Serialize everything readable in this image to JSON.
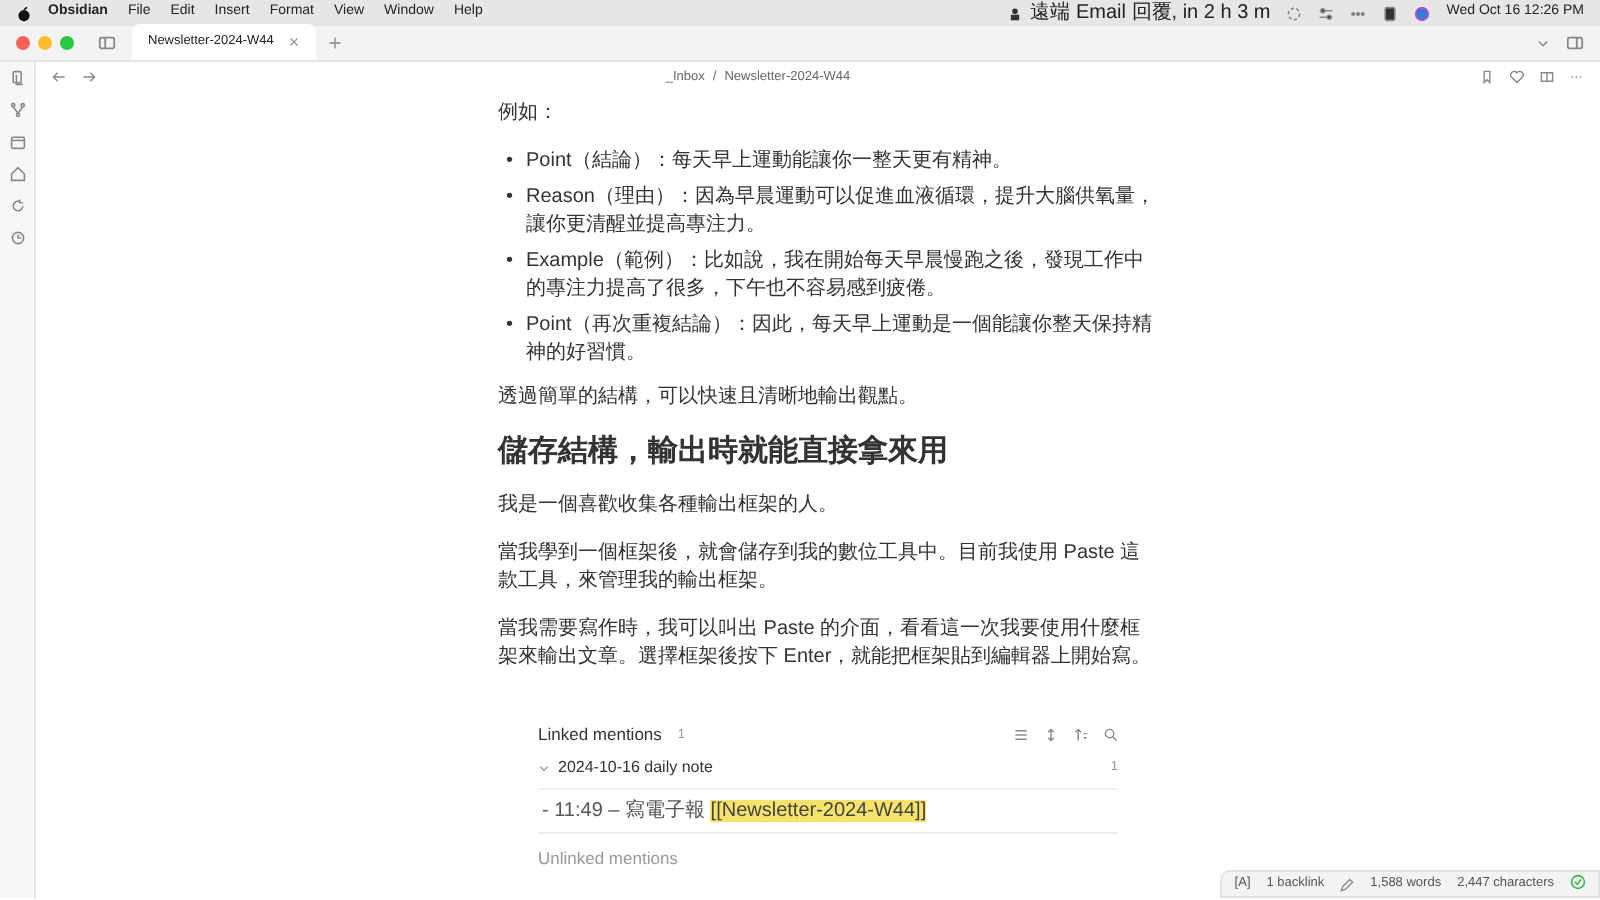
{
  "menubar": {
    "app": "Obsidian",
    "menus": [
      "File",
      "Edit",
      "Insert",
      "Format",
      "View",
      "Window",
      "Help"
    ],
    "reminder": "遠端 Email 回覆, in 2 h 3 m",
    "clock": "Wed Oct 16  12:26 PM"
  },
  "tabs": [
    {
      "title": "Newsletter-2024-W44",
      "selected": true
    }
  ],
  "breadcrumb": {
    "folder": "_Inbox",
    "separator": "/",
    "file": "Newsletter-2024-W44"
  },
  "content": [
    {
      "kind": "paragraph",
      "text": "例如："
    },
    {
      "kind": "bullets",
      "marker": "•",
      "items": [
        "Point（結論）：每天早上運動能讓你一整天更有精神。",
        "Reason（理由）：因為早晨運動可以促進血液循環，提升大腦供氧量，讓你更清醒並提高專注力。",
        "Example（範例）：比如說，我在開始每天早晨慢跑之後，發現工作中的專注力提高了很多，下午也不容易感到疲倦。",
        "Point（再次重複結論）：因此，每天早上運動是一個能讓你整天保持精神的好習慣。"
      ]
    },
    {
      "kind": "paragraph",
      "text": "透過簡單的結構，可以快速且清晰地輸出觀點。"
    },
    {
      "kind": "heading",
      "text": "儲存結構，輸出時就能直接拿來用"
    },
    {
      "kind": "paragraph",
      "text": "我是一個喜歡收集各種輸出框架的人。"
    },
    {
      "kind": "paragraph",
      "text": "當我學到一個框架後，就會儲存到我的數位工具中。目前我使用 Paste 這款工具，來管理我的輸出框架。"
    },
    {
      "kind": "paragraph",
      "text": "當我需要寫作時，我可以叫出 Paste 的介面，看看這一次我要使用什麼框架來輸出文章。選擇框架後按下 Enter，就能把框架貼到編輯器上開始寫。"
    }
  ],
  "backlinks": {
    "title": "Linked mentions",
    "count": "1",
    "groups": [
      {
        "title": "2024-10-16 daily note",
        "count": "1",
        "expanded": true,
        "snippets": [
          {
            "prefix": "- 11:49 – 寫電子報",
            "link": "[[Newsletter-2024-W44]]"
          }
        ]
      }
    ],
    "unlinked_title": "Unlinked mentions"
  },
  "status_bar": {
    "items": [
      {
        "kind": "text",
        "text": "[A]"
      },
      {
        "kind": "text",
        "text": "1 backlink"
      },
      {
        "kind": "edit",
        "text": "1,588 words"
      },
      {
        "kind": "text",
        "text": "2,447 characters"
      }
    ],
    "synced": true
  }
}
